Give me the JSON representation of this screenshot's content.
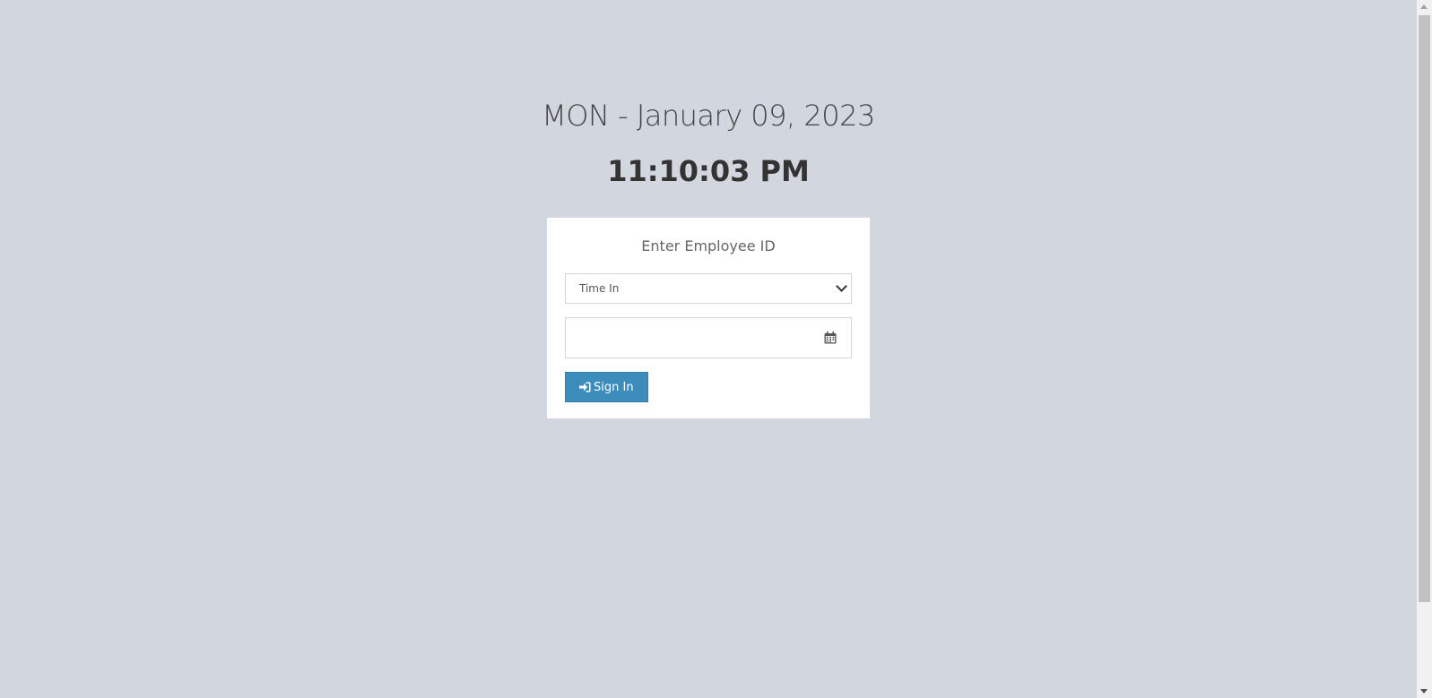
{
  "header": {
    "date": "MON - January 09, 2023",
    "time": "11:10:03 PM"
  },
  "login_box": {
    "message": "Enter Employee ID",
    "status_select": {
      "selected": "Time In"
    },
    "employee_input": {
      "value": "",
      "icon": "calendar-icon"
    },
    "sign_in_button": {
      "label": "Sign In",
      "icon": "sign-in-icon"
    }
  },
  "colors": {
    "page_background": "#d2d6de",
    "box_background": "#ffffff",
    "button_primary": "#3c8dbc"
  }
}
